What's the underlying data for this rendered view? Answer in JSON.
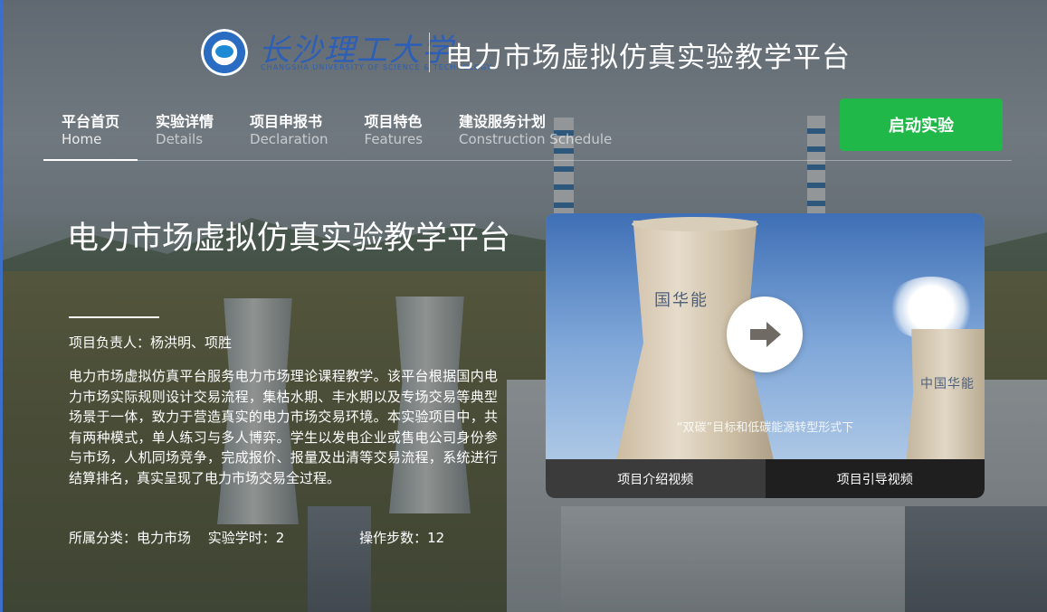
{
  "header": {
    "logo_script": "长沙理工大学",
    "logo_subtitle": "CHANGSHA UNIVERSITY OF SCIENCE & TECHNOLOGY",
    "site_title": "电力市场虚拟仿真实验教学平台"
  },
  "nav": {
    "items": [
      {
        "cn": "平台首页",
        "en": "Home"
      },
      {
        "cn": "实验详情",
        "en": "Details"
      },
      {
        "cn": "项目申报书",
        "en": "Declaration"
      },
      {
        "cn": "项目特色",
        "en": "Features"
      },
      {
        "cn": "建设服务计划",
        "en": "Construction Schedule"
      }
    ],
    "active": "平台首页",
    "start_button": "启动实验"
  },
  "intro": {
    "title": "电力市场虚拟仿真实验教学平台",
    "leader": "项目负责人：杨洪明、项胜",
    "description": "电力市场虚拟仿真平台服务电力市场理论课程教学。该平台根据国内电力市场实际规则设计交易流程，集枯水期、丰水期以及专场交易等典型场景于一体，致力于营造真实的电力市场交易环境。本实验项目中，共有两种模式，单人练习与多人博弈。学生以发电企业或售电公司身份参与市场，人机同场竞争，完成报价、报量及出清等交易流程，系统进行结算排名，真实呈现了电力市场交易全过程。",
    "category": "所属分类：电力市场",
    "hours": "实验学时：2",
    "steps": "操作步数：12"
  },
  "video": {
    "tower_text_1": "国华能",
    "tower_text_2": "中国华能",
    "caption": "“双碳”目标和低碳能源转型形式下",
    "tabs": [
      "项目介绍视频",
      "项目引导视频"
    ]
  },
  "colors": {
    "start_button": "#21b84a",
    "tab_active": "#3b3b3b",
    "tab_inactive": "#1f1f1f"
  }
}
